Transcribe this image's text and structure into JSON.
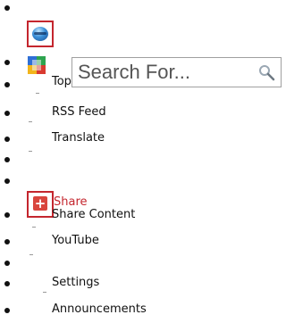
{
  "search": {
    "placeholder": "Search For..."
  },
  "menu": {
    "top_label": "Top",
    "rss_label": "RSS Feed",
    "translate_label": "Translate",
    "share_label": "Share",
    "share_content_label": "Share Content",
    "youtube_label": "YouTube",
    "settings_label": "Settings",
    "announcements_label": "Announcements"
  },
  "colors": {
    "accent_red": "#c4262e",
    "text": "#111111",
    "border": "#a0a0a0"
  },
  "icons": {
    "bubble": "blue-bubble-icon",
    "google": "google-icon",
    "search": "magnifier-icon",
    "share": "share-plus-icon"
  }
}
